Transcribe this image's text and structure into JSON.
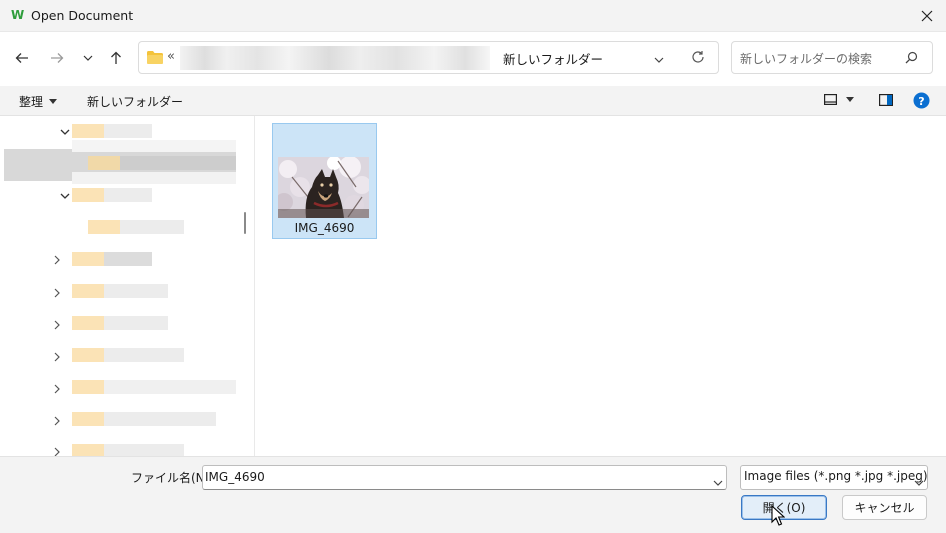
{
  "window": {
    "title": "Open Document",
    "logo_letter": "W",
    "close_glyph": "✕"
  },
  "nav": {
    "back_icon": "back-arrow-icon",
    "forward_icon": "forward-arrow-icon",
    "recent_icon": "chevron-down-icon",
    "up_icon": "up-arrow-icon",
    "address_prefix": "«",
    "current_folder": "新しいフォルダー",
    "search_placeholder": "新しいフォルダーの検索"
  },
  "commands": {
    "organize": "整理",
    "new_folder": "新しいフォルダー"
  },
  "files": [
    {
      "name": "IMG_4690",
      "selected": true
    }
  ],
  "bottom": {
    "filename_label": "ファイル名(N):",
    "filename_value": "IMG_4690",
    "filetype_value": "Image files (*.png *.jpg *.jpeg)",
    "open_label": "開く(O)",
    "cancel_label": "キャンセル"
  },
  "colors": {
    "selection": "#cce4f7",
    "accent": "#0067c0",
    "help": "#0b6fd1",
    "app_logo": "#2e9d3b"
  }
}
